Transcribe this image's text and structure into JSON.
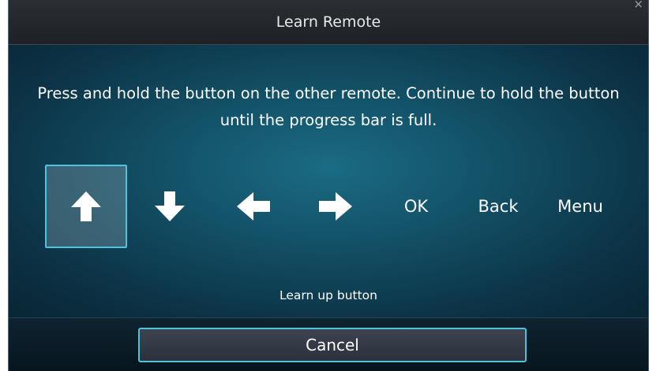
{
  "dialog": {
    "title": "Learn Remote",
    "close_glyph": "×"
  },
  "instructions": "Press and hold the button on the other remote. Continue to hold the button until the progress bar is full.",
  "keys": [
    {
      "icon": "arrow-up-icon",
      "label": "",
      "selected": true
    },
    {
      "icon": "arrow-down-icon",
      "label": "",
      "selected": false
    },
    {
      "icon": "arrow-left-icon",
      "label": "",
      "selected": false
    },
    {
      "icon": "arrow-right-icon",
      "label": "",
      "selected": false
    },
    {
      "icon": "",
      "label": "OK",
      "selected": false
    },
    {
      "icon": "",
      "label": "Back",
      "selected": false
    },
    {
      "icon": "",
      "label": "Menu",
      "selected": false
    }
  ],
  "status": "Learn up button",
  "cancel_label": "Cancel",
  "colors": {
    "accent": "#4fc3dc",
    "background": "#124e64",
    "titlebar": "#24282c"
  }
}
